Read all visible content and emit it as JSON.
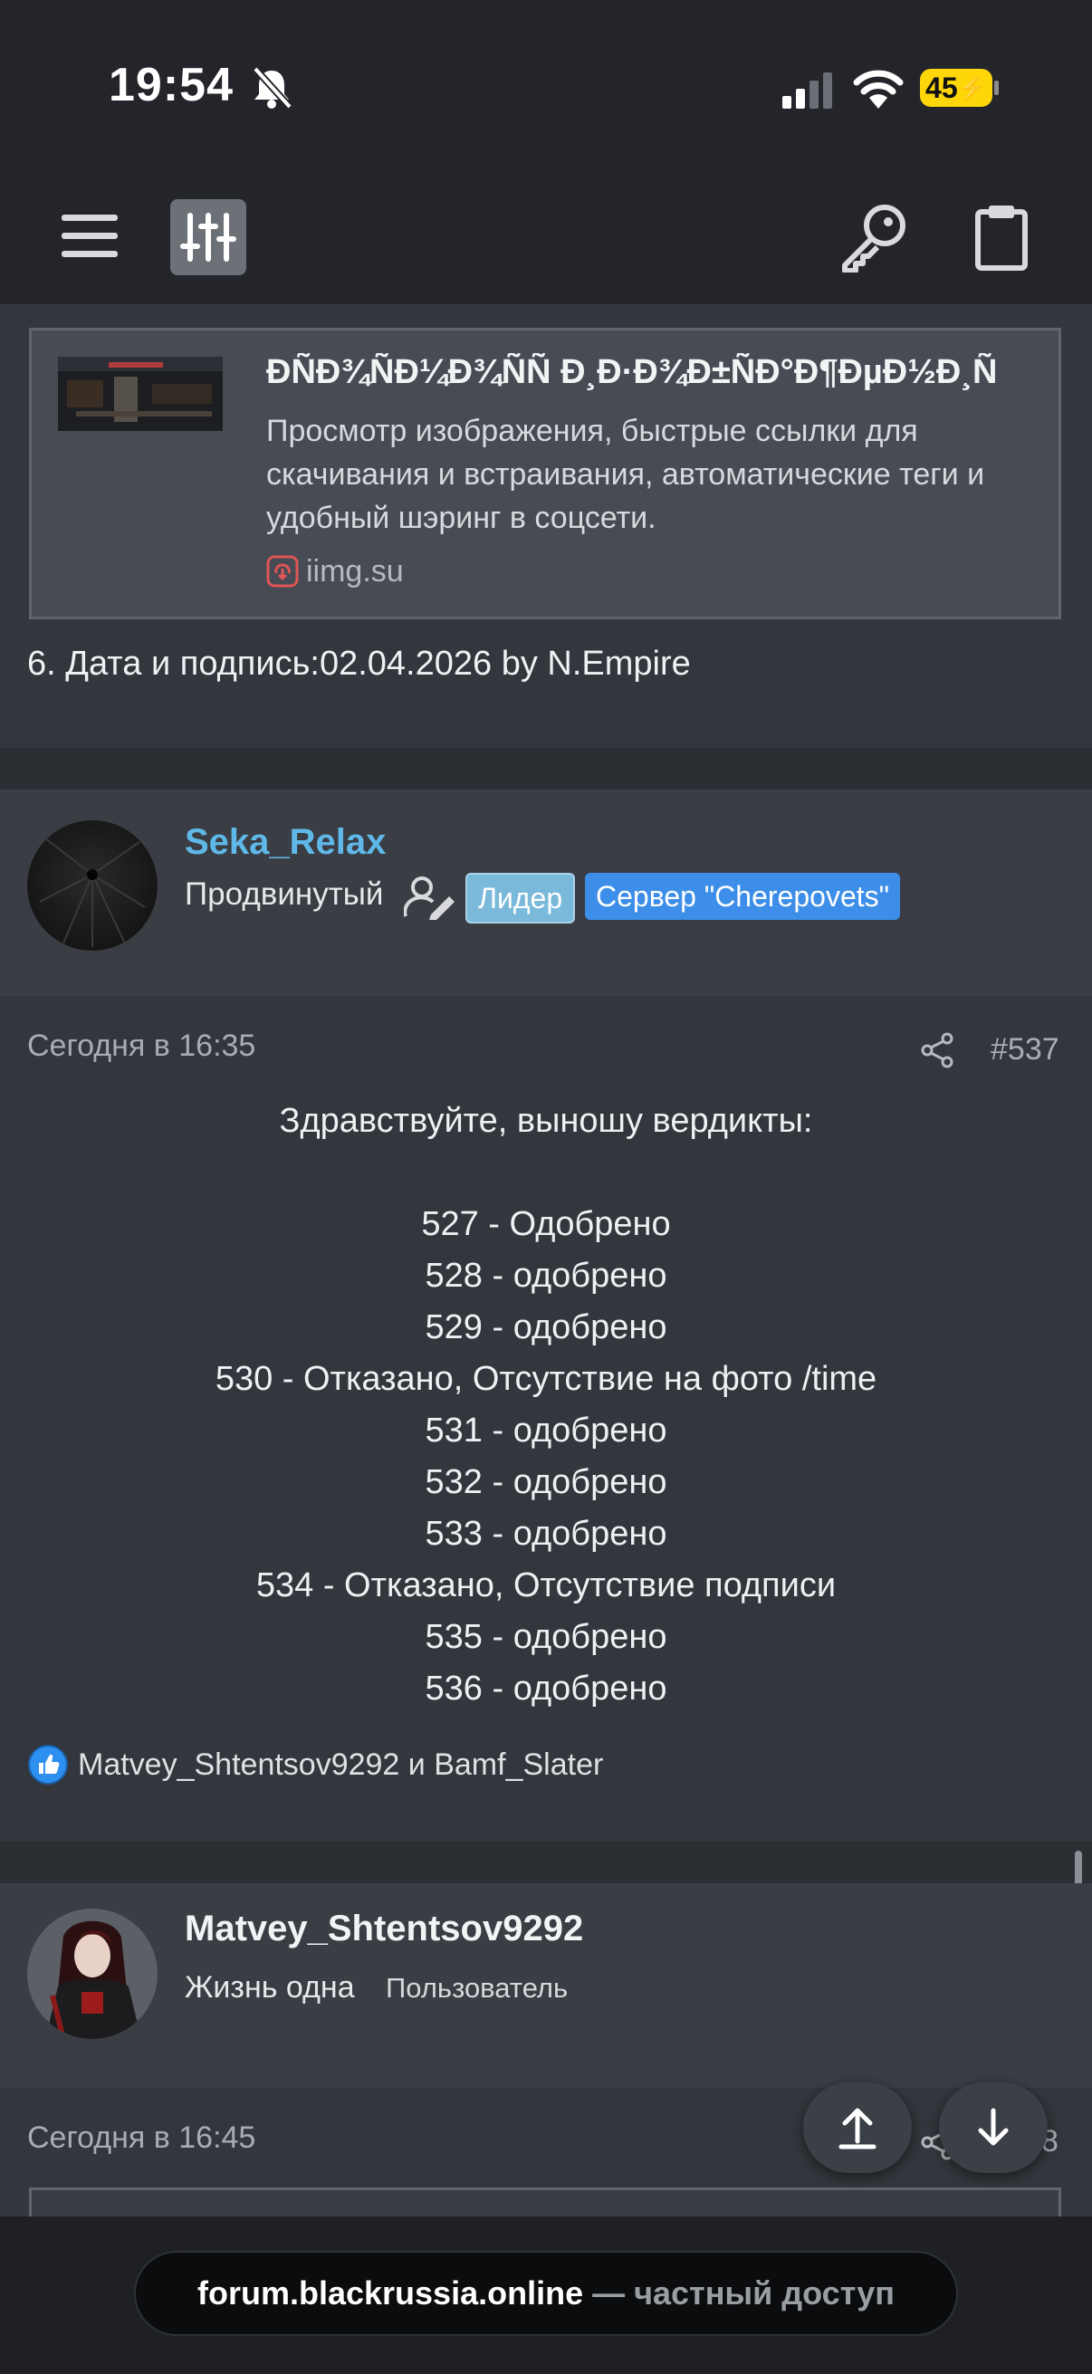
{
  "status_bar": {
    "time": "19:54",
    "battery": "45"
  },
  "embed": {
    "title": "ÐÑÐ¾ÑÐ¼Ð¾ÑÑ Ð¸Ð·Ð¾Ð±ÑÐ°Ð¶ÐµÐ½Ð¸Ñ",
    "description": "Просмотр изображения, быстрые ссылки для скачивания и встраивания, автоматические теги и удобный шэринг в соцсети.",
    "site": "iimg.su"
  },
  "signature_line": "6. Дата и подпись:02.04.2026 by N.Empire",
  "post537": {
    "username": "Seka_Relax",
    "user_title": "Продвинутый",
    "badges": [
      "Лидер",
      "Сервер \"Cherepovets\""
    ],
    "time": "Сегодня в 16:35",
    "number": "#537",
    "greeting": "Здравствуйте, выношу вердикты:",
    "verdicts": [
      "527 - Одобрено",
      "528 - одобрено",
      "529 - одобрено",
      "530 - Отказано, Отсутствие на фото /time",
      "531 - одобрено",
      "532 - одобрено",
      "533 - одобрено",
      "534 - Отказано, Отсутствие подписи",
      "535 - одобрено",
      "536 - одобрено"
    ],
    "reactions": "Matvey_Shtentsov9292 и Bamf_Slater"
  },
  "post538": {
    "username": "Matvey_Shtentsov9292",
    "user_title": "Жизнь одна",
    "user_role": "Пользователь",
    "time": "Сегодня в 16:45",
    "number_partial": "8"
  },
  "browser": {
    "domain": "forum.blackrussia.online",
    "suffix": " — частный доступ"
  },
  "colors": {
    "username_link": "#5fb8e8",
    "leader_badge": "#7ab9da",
    "server_badge": "#3d8ee8"
  }
}
